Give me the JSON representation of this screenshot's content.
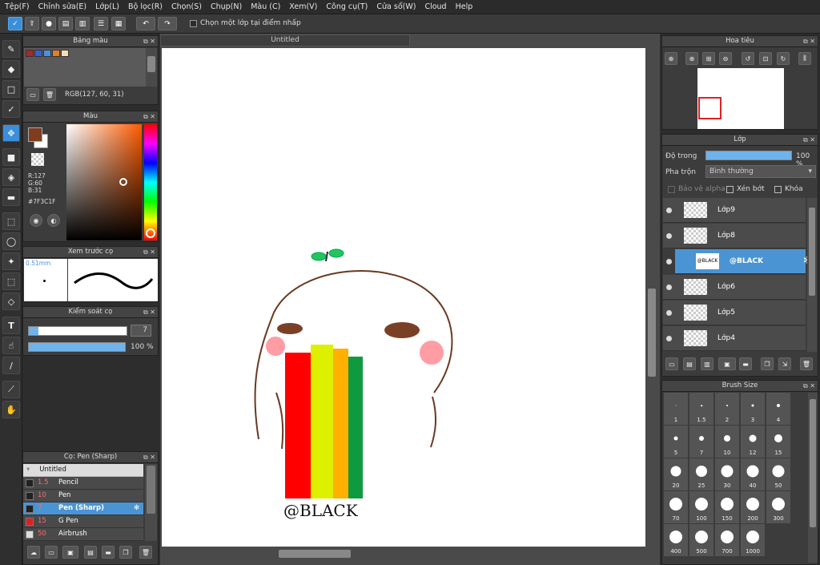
{
  "menu": [
    "Tệp(F)",
    "Chỉnh sửa(E)",
    "Lớp(L)",
    "Bộ lọc(R)",
    "Chọn(S)",
    "Chụp(N)",
    "Màu (C)",
    "Xem(V)",
    "Công cụ(T)",
    "Cửa sổ(W)",
    "Cloud",
    "Help"
  ],
  "toolbar": {
    "checkbox_label": "Chọn một lớp tại điểm nhấp"
  },
  "palette": {
    "title": "Bảng màu",
    "rgb": "RGB(127, 60, 31)",
    "swatches": [
      "#a52a2a",
      "#3b5fcf",
      "#4a90e2",
      "#e67e22",
      "#f5deb3"
    ]
  },
  "color": {
    "title": "Màu",
    "r": "R:127",
    "g": "G:60",
    "b": "B:31",
    "hex": "#7F3C1F",
    "fg": "#7f3c1f"
  },
  "preview": {
    "title": "Xem trước cọ",
    "size": "0.51mm"
  },
  "brush_control": {
    "title": "Kiểm soát cọ",
    "size_value": "7",
    "opacity_value": "100 %",
    "opacity_fraction": 1.0,
    "size_fraction": 0.1
  },
  "brush_list": {
    "title": "Cọ: Pen (Sharp)",
    "group": "Untitled",
    "items": [
      {
        "size": "1.5",
        "name": "Pencil",
        "color": "#222"
      },
      {
        "size": "10",
        "name": "Pen",
        "color": "#222"
      },
      {
        "size": "7",
        "name": "Pen (Sharp)",
        "color": "#222",
        "selected": true
      },
      {
        "size": "15",
        "name": "G Pen",
        "color": "#e02020"
      },
      {
        "size": "50",
        "name": "Airbrush",
        "color": "#ddd"
      }
    ]
  },
  "canvas": {
    "tab": "Untitled",
    "text": "@BLACK"
  },
  "navigator": {
    "title": "Hoa tiêu"
  },
  "layers": {
    "title": "Lớp",
    "opacity_label": "Độ trong",
    "opacity_value": "100 %",
    "opacity_fraction": 1.0,
    "blend_label": "Pha trộn",
    "blend_value": "Bình thường",
    "protect_alpha": "Bảo vệ alpha",
    "clip": "Xén bớt",
    "lock": "Khóa",
    "items": [
      {
        "name": "Lớp9"
      },
      {
        "name": "Lớp8"
      },
      {
        "name": "@BLACK",
        "selected": true,
        "thumb_text": "@BLACK"
      },
      {
        "name": "Lớp6"
      },
      {
        "name": "Lớp5"
      },
      {
        "name": "Lớp4"
      }
    ]
  },
  "brush_size": {
    "title": "Brush Size",
    "sizes": [
      "1",
      "1.5",
      "2",
      "3",
      "4",
      "5",
      "7",
      "10",
      "12",
      "15",
      "20",
      "25",
      "30",
      "40",
      "50",
      "70",
      "100",
      "150",
      "200",
      "300",
      "400",
      "500",
      "700",
      "1000"
    ]
  }
}
